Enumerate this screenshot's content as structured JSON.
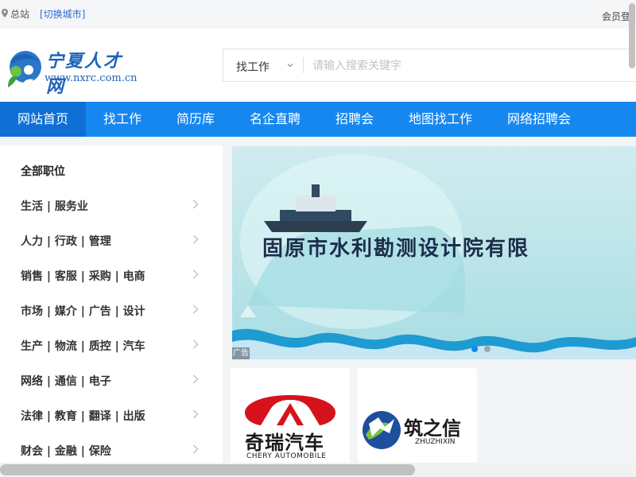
{
  "topbar": {
    "location": "总站",
    "switch_city": "[切换城市]",
    "member_login": "会员登"
  },
  "logo": {
    "title": "宁夏人才网",
    "url": "www.nxrc.com.cn"
  },
  "search": {
    "type": "找工作",
    "placeholder": "请输入搜索关键字"
  },
  "nav": {
    "items": [
      {
        "label": "网站首页",
        "active": true
      },
      {
        "label": "找工作"
      },
      {
        "label": "简历库"
      },
      {
        "label": "名企直聘"
      },
      {
        "label": "招聘会"
      },
      {
        "label": "地图找工作"
      },
      {
        "label": "网络招聘会"
      }
    ]
  },
  "sidebar": {
    "title": "全部职位",
    "items": [
      {
        "label": "生活 | 服务业"
      },
      {
        "label": "人力 | 行政 | 管理"
      },
      {
        "label": "销售 | 客服 | 采购 | 电商"
      },
      {
        "label": "市场 | 媒介 | 广告 | 设计"
      },
      {
        "label": "生产 | 物流 | 质控 | 汽车"
      },
      {
        "label": "网络 | 通信 | 电子"
      },
      {
        "label": "法律 | 教育 | 翻译 | 出版"
      },
      {
        "label": "财会 | 金融 | 保险"
      }
    ]
  },
  "banner": {
    "text": "固原市水利勘测设计院有限",
    "ad_tag": "广告",
    "dots": [
      {
        "active": true
      },
      {
        "active": false
      }
    ]
  },
  "cards": [
    {
      "name": "奇瑞汽车",
      "sub": "CHERY AUTOMOBILE",
      "brand_color": "#d6131c"
    },
    {
      "name": "筑之信",
      "sub": "ZHUZHIXIN",
      "brand_color": "#1e4f9c"
    }
  ],
  "colors": {
    "nav_bg": "#1787f0",
    "nav_active": "#0f6fd4",
    "link": "#2a6ad8"
  }
}
